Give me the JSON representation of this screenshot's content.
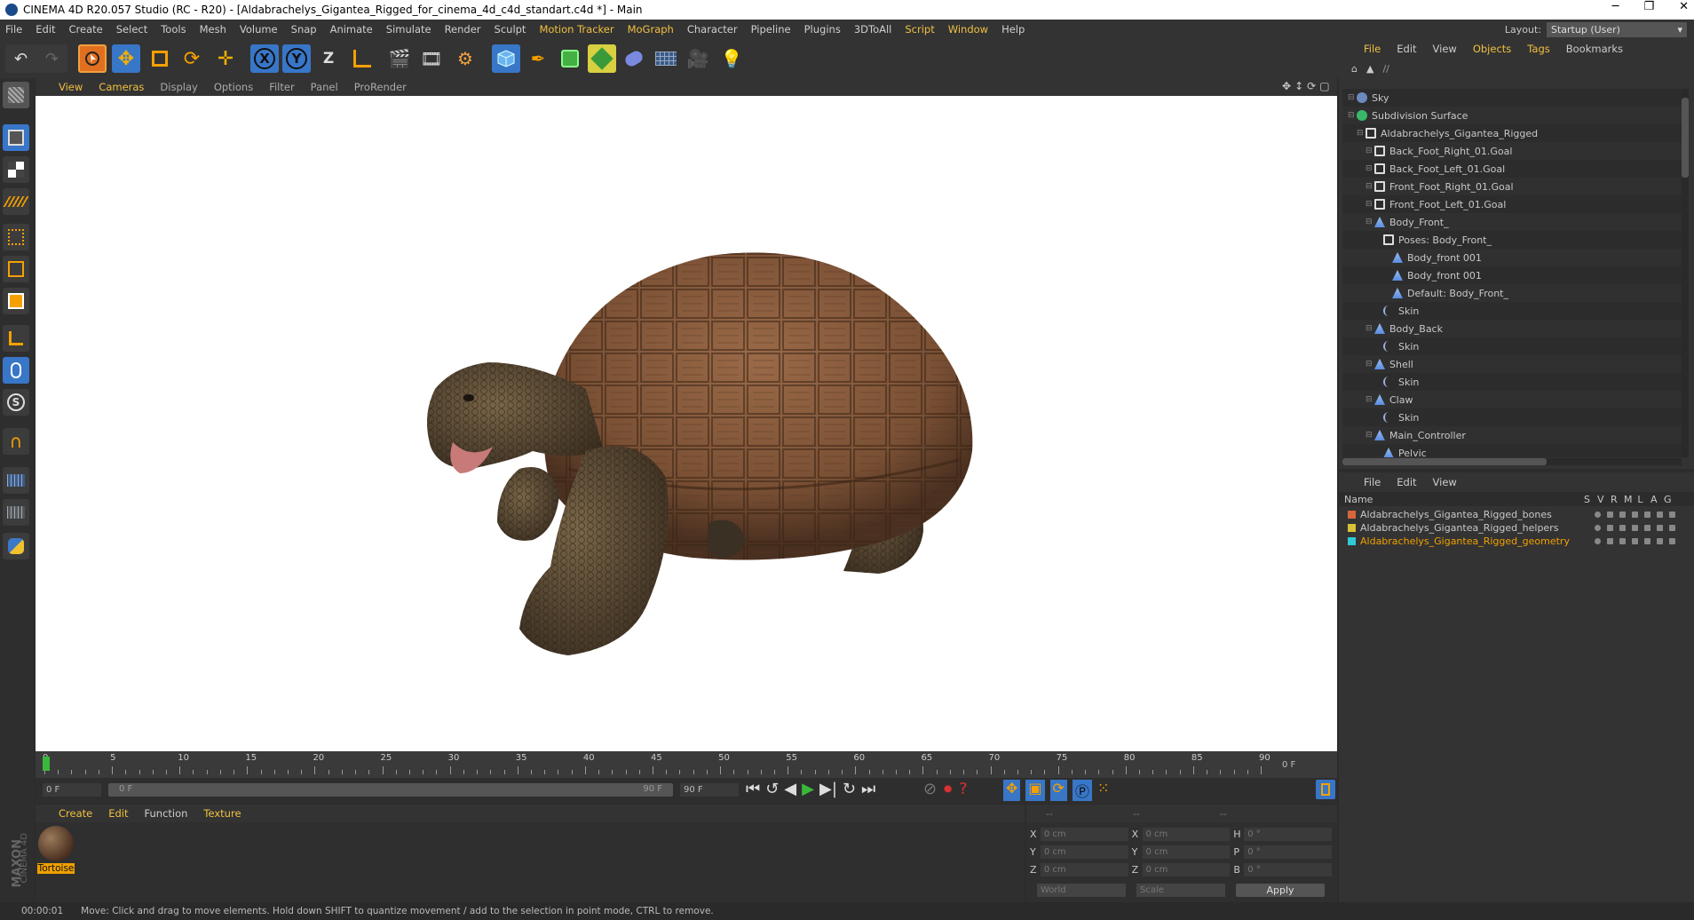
{
  "window": {
    "title": "CINEMA 4D R20.057 Studio (RC - R20) - [Aldabrachelys_Gigantea_Rigged_for_cinema_4d_c4d_standart.c4d *] - Main",
    "minimize": "─",
    "restore": "❐",
    "close": "✕"
  },
  "menu": [
    "File",
    "Edit",
    "Create",
    "Select",
    "Tools",
    "Mesh",
    "Volume",
    "Snap",
    "Animate",
    "Simulate",
    "Render",
    "Sculpt",
    "Motion Tracker",
    "MoGraph",
    "Character",
    "Pipeline",
    "Plugins",
    "3DToAll",
    "Script",
    "Window",
    "Help"
  ],
  "layout": {
    "label": "Layout:",
    "value": "Startup (User)"
  },
  "viewport_menu": [
    "View",
    "Cameras",
    "Display",
    "Options",
    "Filter",
    "Panel",
    "ProRender"
  ],
  "objects_menu": [
    "File",
    "Edit",
    "View",
    "Objects",
    "Tags",
    "Bookmarks"
  ],
  "objects_path": "//",
  "tree": [
    {
      "name": "Sky",
      "depth": 0,
      "icon": "sky"
    },
    {
      "name": "Subdivision Surface",
      "depth": 0,
      "icon": "subdiv"
    },
    {
      "name": "Aldabrachelys_Gigantea_Rigged",
      "depth": 1,
      "icon": "null"
    },
    {
      "name": "Back_Foot_Right_01.Goal",
      "depth": 2,
      "icon": "null"
    },
    {
      "name": "Back_Foot_Left_01.Goal",
      "depth": 2,
      "icon": "null"
    },
    {
      "name": "Front_Foot_Right_01.Goal",
      "depth": 2,
      "icon": "null"
    },
    {
      "name": "Front_Foot_Left_01.Goal",
      "depth": 2,
      "icon": "null"
    },
    {
      "name": "Body_Front_",
      "depth": 2,
      "icon": "joint"
    },
    {
      "name": "Poses: Body_Front_",
      "depth": 3,
      "icon": "null"
    },
    {
      "name": "Body_front 001",
      "depth": 4,
      "icon": "joint"
    },
    {
      "name": "Body_front 001",
      "depth": 4,
      "icon": "joint"
    },
    {
      "name": "Default: Body_Front_",
      "depth": 4,
      "icon": "joint"
    },
    {
      "name": "Skin",
      "depth": 3,
      "icon": "skin"
    },
    {
      "name": "Body_Back",
      "depth": 2,
      "icon": "joint"
    },
    {
      "name": "Skin",
      "depth": 3,
      "icon": "skin"
    },
    {
      "name": "Shell",
      "depth": 2,
      "icon": "joint"
    },
    {
      "name": "Skin",
      "depth": 3,
      "icon": "skin"
    },
    {
      "name": "Claw",
      "depth": 2,
      "icon": "joint"
    },
    {
      "name": "Skin",
      "depth": 3,
      "icon": "skin"
    },
    {
      "name": "Main_Controller",
      "depth": 2,
      "icon": "joint"
    },
    {
      "name": "Pelvic",
      "depth": 3,
      "icon": "joint"
    }
  ],
  "layers_menu": [
    "File",
    "Edit",
    "View"
  ],
  "layers_header": {
    "name": "Name",
    "cols": [
      "S",
      "V",
      "R",
      "M",
      "L",
      "A",
      "G"
    ]
  },
  "layers": [
    {
      "name": "Aldabrachelys_Gigantea_Rigged_bones",
      "color": "#d9663a",
      "active": false
    },
    {
      "name": "Aldabrachelys_Gigantea_Rigged_helpers",
      "color": "#d8c234",
      "active": false
    },
    {
      "name": "Aldabrachelys_Gigantea_Rigged_geometry",
      "color": "#2fc9d8",
      "active": true
    }
  ],
  "timeline": {
    "ticks": [
      "0",
      "5",
      "10",
      "15",
      "20",
      "25",
      "30",
      "35",
      "40",
      "45",
      "50",
      "55",
      "60",
      "65",
      "70",
      "75",
      "80",
      "85",
      "90"
    ],
    "frame_right": "0 F"
  },
  "transport": {
    "start": "0 F",
    "slider_left": "0 F",
    "slider_right": "90 F",
    "end": "90 F"
  },
  "material_menu": [
    "Create",
    "Edit",
    "Function",
    "Texture"
  ],
  "material": {
    "name": "Tortoise"
  },
  "coords": {
    "x_pos": "0 cm",
    "y_pos": "0 cm",
    "z_pos": "0 cm",
    "x_size": "0 cm",
    "y_size": "0 cm",
    "z_size": "0 cm",
    "h": "0 °",
    "p": "0 °",
    "b": "0 °",
    "labels": {
      "x": "X",
      "y": "Y",
      "z": "Z",
      "h": "H",
      "p": "P",
      "b": "B"
    },
    "header_left": "--",
    "header_mid": "--",
    "header_right": "--",
    "world": "World",
    "scale": "Scale",
    "apply": "Apply"
  },
  "status": {
    "time": "00:00:01",
    "message": "Move: Click and drag to move elements. Hold down SHIFT to quantize movement / add to the selection in point mode, CTRL to remove."
  },
  "branding": {
    "maxon": "MAXON",
    "cinema": "CINEMA 4D"
  },
  "toolbar_axes": {
    "x": "X",
    "y": "Y",
    "z": "Z"
  }
}
